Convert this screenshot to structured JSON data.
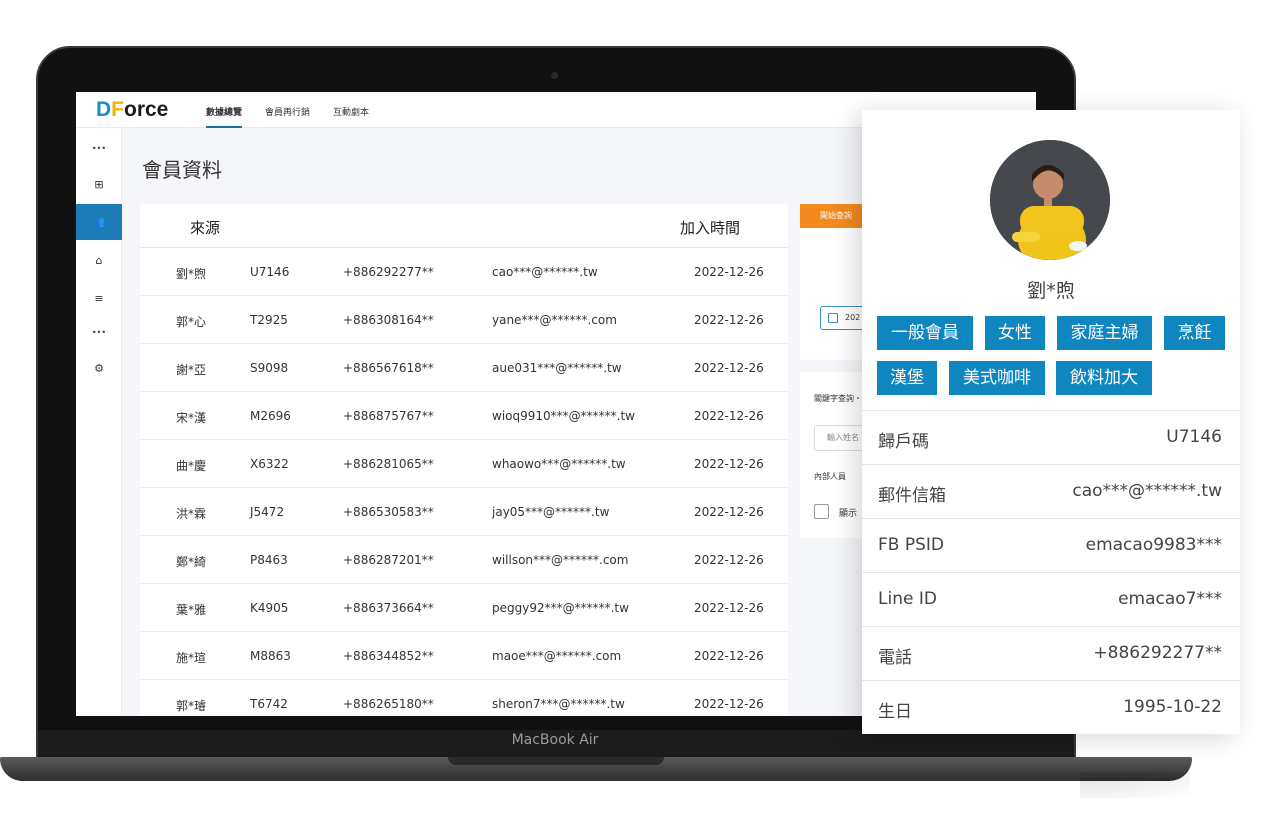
{
  "device_label": "MacBook Air",
  "app": {
    "logo": {
      "d": "D",
      "f": "F",
      "rest": "orce"
    },
    "nav": [
      "數據總覽",
      "會員再行銷",
      "互動劇本"
    ],
    "page_title": "會員資料"
  },
  "sidebar": {
    "items": [
      {
        "icon": "more-dots-icon",
        "glyph": "•••"
      },
      {
        "icon": "dashboard-icon",
        "glyph": "⊞"
      },
      {
        "icon": "members-icon",
        "glyph": "👥"
      },
      {
        "icon": "tag-icon",
        "glyph": "⌂"
      },
      {
        "icon": "database-icon",
        "glyph": "≡"
      },
      {
        "icon": "more-dots-icon",
        "glyph": "•••"
      },
      {
        "icon": "settings-icon",
        "glyph": "⚙"
      }
    ]
  },
  "table": {
    "headers": {
      "source": "來源",
      "joined": "加入時間"
    },
    "rows": [
      {
        "name": "劉*煦",
        "code": "U7146",
        "phone": "+886292277**",
        "email": "cao***@******.tw",
        "date": "2022-12-26"
      },
      {
        "name": "郭*心",
        "code": "T2925",
        "phone": "+886308164**",
        "email": "yane***@******.com",
        "date": "2022-12-26"
      },
      {
        "name": "謝*亞",
        "code": "S9098",
        "phone": "+886567618**",
        "email": "aue031***@******.tw",
        "date": "2022-12-26"
      },
      {
        "name": "宋*漢",
        "code": "M2696",
        "phone": "+886875767**",
        "email": "wioq9910***@******.tw",
        "date": "2022-12-26"
      },
      {
        "name": "曲*慶",
        "code": "X6322",
        "phone": "+886281065**",
        "email": "whaowo***@******.tw",
        "date": "2022-12-26"
      },
      {
        "name": "洪*霖",
        "code": "J5472",
        "phone": "+886530583**",
        "email": "jay05***@******.tw",
        "date": "2022-12-26"
      },
      {
        "name": "鄭*綺",
        "code": "P8463",
        "phone": "+886287201**",
        "email": "willson***@******.com",
        "date": "2022-12-26"
      },
      {
        "name": "葉*雅",
        "code": "K4905",
        "phone": "+886373664**",
        "email": "peggy92***@******.tw",
        "date": "2022-12-26"
      },
      {
        "name": "施*瑄",
        "code": "M8863",
        "phone": "+886344852**",
        "email": "maoe***@******.com",
        "date": "2022-12-26"
      },
      {
        "name": "郭*璿",
        "code": "T6742",
        "phone": "+886265180**",
        "email": "sheron7***@******.tw",
        "date": "2022-12-26"
      }
    ]
  },
  "side_panel": {
    "query_button": "開始查詢",
    "date_value": "202",
    "keyword_label": "關鍵字查詢・",
    "name_placeholder": "輸入姓名",
    "internal_label": "內部人員",
    "display_label": "顯示"
  },
  "profile": {
    "name": "劉*煦",
    "tags": [
      "一般會員",
      "女性",
      "家庭主婦",
      "烹飪",
      "漢堡",
      "美式咖啡",
      "飲料加大"
    ],
    "fields": [
      {
        "label": "歸戶碼",
        "value": "U7146"
      },
      {
        "label": "郵件信箱",
        "value": "cao***@******.tw"
      },
      {
        "label": "FB PSID",
        "value": "emacao9983***"
      },
      {
        "label": "Line ID",
        "value": "emacao7***"
      },
      {
        "label": "電話",
        "value": "+886292277**"
      },
      {
        "label": "生日",
        "value": "1995-10-22"
      }
    ]
  },
  "colors": {
    "accent": "#0f86c0",
    "sidebar_active": "#1d7cb8",
    "query_button": "#f28a1e",
    "logo_d": "#1591c8",
    "logo_f": "#f4b400"
  }
}
